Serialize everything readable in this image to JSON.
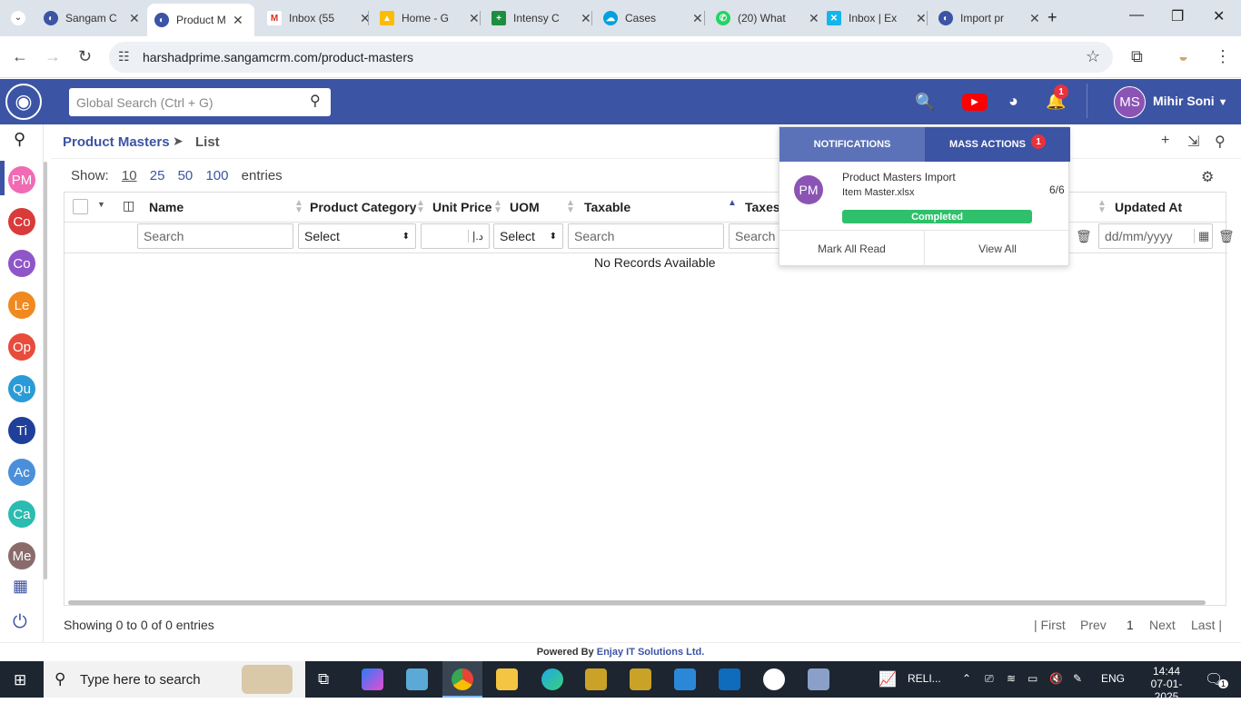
{
  "browser": {
    "tabs": [
      {
        "title": "Sangam C",
        "active": false
      },
      {
        "title": "Product M",
        "active": true
      },
      {
        "title": "Inbox (55",
        "active": false
      },
      {
        "title": "Home - G",
        "active": false
      },
      {
        "title": "Intensy C",
        "active": false
      },
      {
        "title": "Cases",
        "active": false
      },
      {
        "title": "(20) What",
        "active": false
      },
      {
        "title": "Inbox | Ex",
        "active": false
      },
      {
        "title": "Import pr",
        "active": false
      }
    ],
    "url": "harshadprime.sangamcrm.com/product-masters"
  },
  "header": {
    "search_placeholder": "Global Search (Ctrl + G)",
    "notification_count": "1",
    "user_initials": "MS",
    "user_name": "Mihir Soni"
  },
  "rail": {
    "modules": [
      {
        "label": "PM",
        "color": "#f06bb4"
      },
      {
        "label": "Co",
        "color": "#d93a3a"
      },
      {
        "label": "Co",
        "color": "#8f56c7"
      },
      {
        "label": "Le",
        "color": "#f0891f"
      },
      {
        "label": "Op",
        "color": "#e84c3d"
      },
      {
        "label": "Qu",
        "color": "#2a9bd6"
      },
      {
        "label": "Ti",
        "color": "#1f3f9a"
      },
      {
        "label": "Ac",
        "color": "#4a8fd9"
      },
      {
        "label": "Ca",
        "color": "#2bbcb0"
      },
      {
        "label": "Me",
        "color": "#8a6b6b"
      }
    ]
  },
  "breadcrumb": {
    "module": "Product Masters",
    "sep": "➤",
    "page": "List"
  },
  "entries": {
    "show": "Show:",
    "options": [
      "10",
      "25",
      "50",
      "100"
    ],
    "suffix": "entries"
  },
  "grid": {
    "columns": [
      "Name",
      "Product Category",
      "Unit Price",
      "UOM",
      "Taxable",
      "Taxes",
      "Updated At"
    ],
    "filters": {
      "name": "Search",
      "category": "Select",
      "unit_price_sym": "د.إ",
      "uom": "Select",
      "taxable": "Search",
      "taxes": "Search",
      "updated_at": "dd/mm/yyyy"
    },
    "empty": "No Records Available"
  },
  "footer": {
    "showing": "Showing 0 to 0 of 0 entries",
    "first": "| First",
    "prev": "Prev",
    "page": "1",
    "next": "Next",
    "last": "Last |",
    "powered_by": "Powered By",
    "company": "Enjay IT Solutions Ltd."
  },
  "notifications": {
    "tab_notifications": "NOTIFICATIONS",
    "tab_mass_actions": "MASS ACTIONS",
    "mass_actions_count": "1",
    "item": {
      "initials": "PM",
      "title": "Product Masters Import",
      "file": "Item Master.xlsx",
      "count": "6/6",
      "status": "Completed",
      "progress": 1.0
    },
    "mark_all_read": "Mark All Read",
    "view_all": "View All"
  },
  "taskbar": {
    "search_placeholder": "Type here to search",
    "tray_text": "RELI...",
    "lang": "ENG",
    "time": "14:44",
    "date": "07-01-2025",
    "notif_count": "1"
  }
}
